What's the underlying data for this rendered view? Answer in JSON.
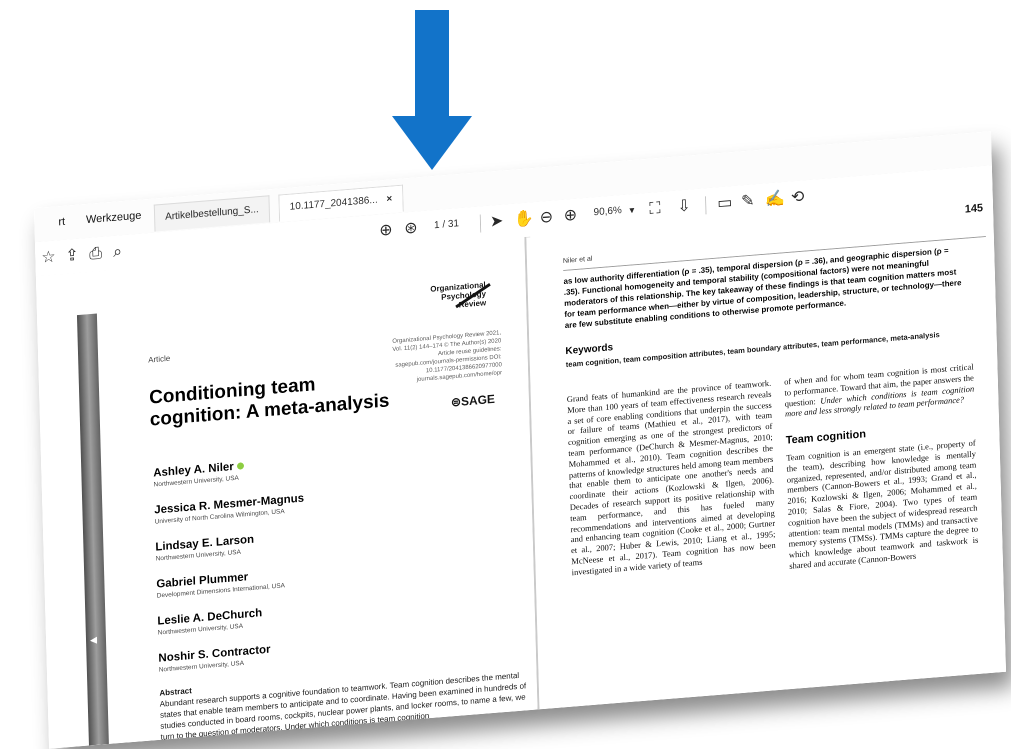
{
  "colors": {
    "arrow": "#1273c9"
  },
  "tabs": {
    "menu_partial": "rt",
    "menu_tools": "Werkzeuge",
    "tab1": "Artikelbestellung_S...",
    "tab2": "10.1177_2041386...",
    "close": "×"
  },
  "toolbar": {
    "page_current": "1",
    "page_total": "/ 31",
    "zoom": "90,6%"
  },
  "left_page": {
    "journal_logo": "Organizational\nPsychology\nReview",
    "article_label": "Article",
    "pubinfo": "Organizational Psychology Review 2021, Vol. 11(2) 144–174 © The Author(s) 2020 Article reuse guidelines: sagepub.com/journals-permissions DOI: 10.1177/2041386620977000 journals.sagepub.com/home/opr",
    "sage": "⊜SAGE",
    "title": "Conditioning team cognition: A meta-analysis",
    "authors": [
      {
        "name": "Ashley A. Niler",
        "aff": "Northwestern University, USA"
      },
      {
        "name": "Jessica R. Mesmer-Magnus",
        "aff": "University of North Carolina Wilmington, USA"
      },
      {
        "name": "Lindsay E. Larson",
        "aff": "Northwestern University, USA"
      },
      {
        "name": "Gabriel Plummer",
        "aff": "Development Dimensions International, USA"
      },
      {
        "name": "Leslie A. DeChurch",
        "aff": "Northwestern University, USA"
      },
      {
        "name": "Noshir S. Contractor",
        "aff": "Northwestern University, USA"
      }
    ],
    "abstract_heading": "Abstract",
    "abstract": "Abundant research supports a cognitive foundation to teamwork. Team cognition describes the mental states that enable team members to anticipate and to coordinate. Having been examined in hundreds of studies conducted in board rooms, cockpits, nuclear power plants, and locker rooms, to name a few, we turn to the question of moderators. Under which conditions is team cognition"
  },
  "right_page": {
    "running_head": "Niler et al",
    "page_number": "145",
    "intro": "as low authority differentiation (ρ = .35), temporal dispersion (ρ = .36), and geographic dispersion (ρ = .35). Functional homogeneity and temporal stability (compositional factors) were not meaningful moderators of this relationship. The key takeaway of these findings is that team cognition matters most for team performance when—either by virtue of composition, leadership, structure, or technology—there are few substitute enabling conditions to otherwise promote performance.",
    "keywords_heading": "Keywords",
    "keywords": "team cognition, team composition attributes, team boundary attributes, team performance, meta-analysis",
    "col1": "Grand feats of humankind are the province of teamwork. More than 100 years of team effectiveness research reveals a set of core enabling conditions that underpin the success or failure of teams (Mathieu et al., 2017), with team cognition emerging as one of the strongest predictors of team performance (DeChurch & Mesmer-Magnus, 2010; Mohammed et al., 2010). Team cognition describes the patterns of knowledge structures held among team members that enable them to anticipate one another's needs and coordinate their actions (Kozlowski & Ilgen, 2006). Decades of research support its positive relationship with team performance, and this has fueled many recommendations and interventions aimed at developing and enhancing team cognition (Cooke et al., 2000; Gurtner et al., 2007; Huber & Lewis, 2010; Liang et al., 1995; McNeese et al., 2017). Team cognition has now been investigated in a wide variety of teams",
    "col2_a": "of when and for whom team cognition is most critical to performance. Toward that aim, the paper answers the question: ",
    "col2_q": "Under which conditions is team cognition more and less strongly related to team performance?",
    "section_heading": "Team cognition",
    "col2_b": "Team cognition is an emergent state (i.e., property of the team), describing how knowledge is mentally organized, represented, and/or distributed among team members (Cannon-Bowers et al., 1993; Grand et al., 2016; Kozlowski & Ilgen, 2006; Mohammed et al., 2010; Salas & Fiore, 2004). Two types of team cognition have been the subject of widespread research attention: team mental models (TMMs) and transactive memory systems (TMSs). TMMs capture the degree to which knowledge about teamwork and taskwork is shared and accurate (Cannon-Bowers"
  }
}
